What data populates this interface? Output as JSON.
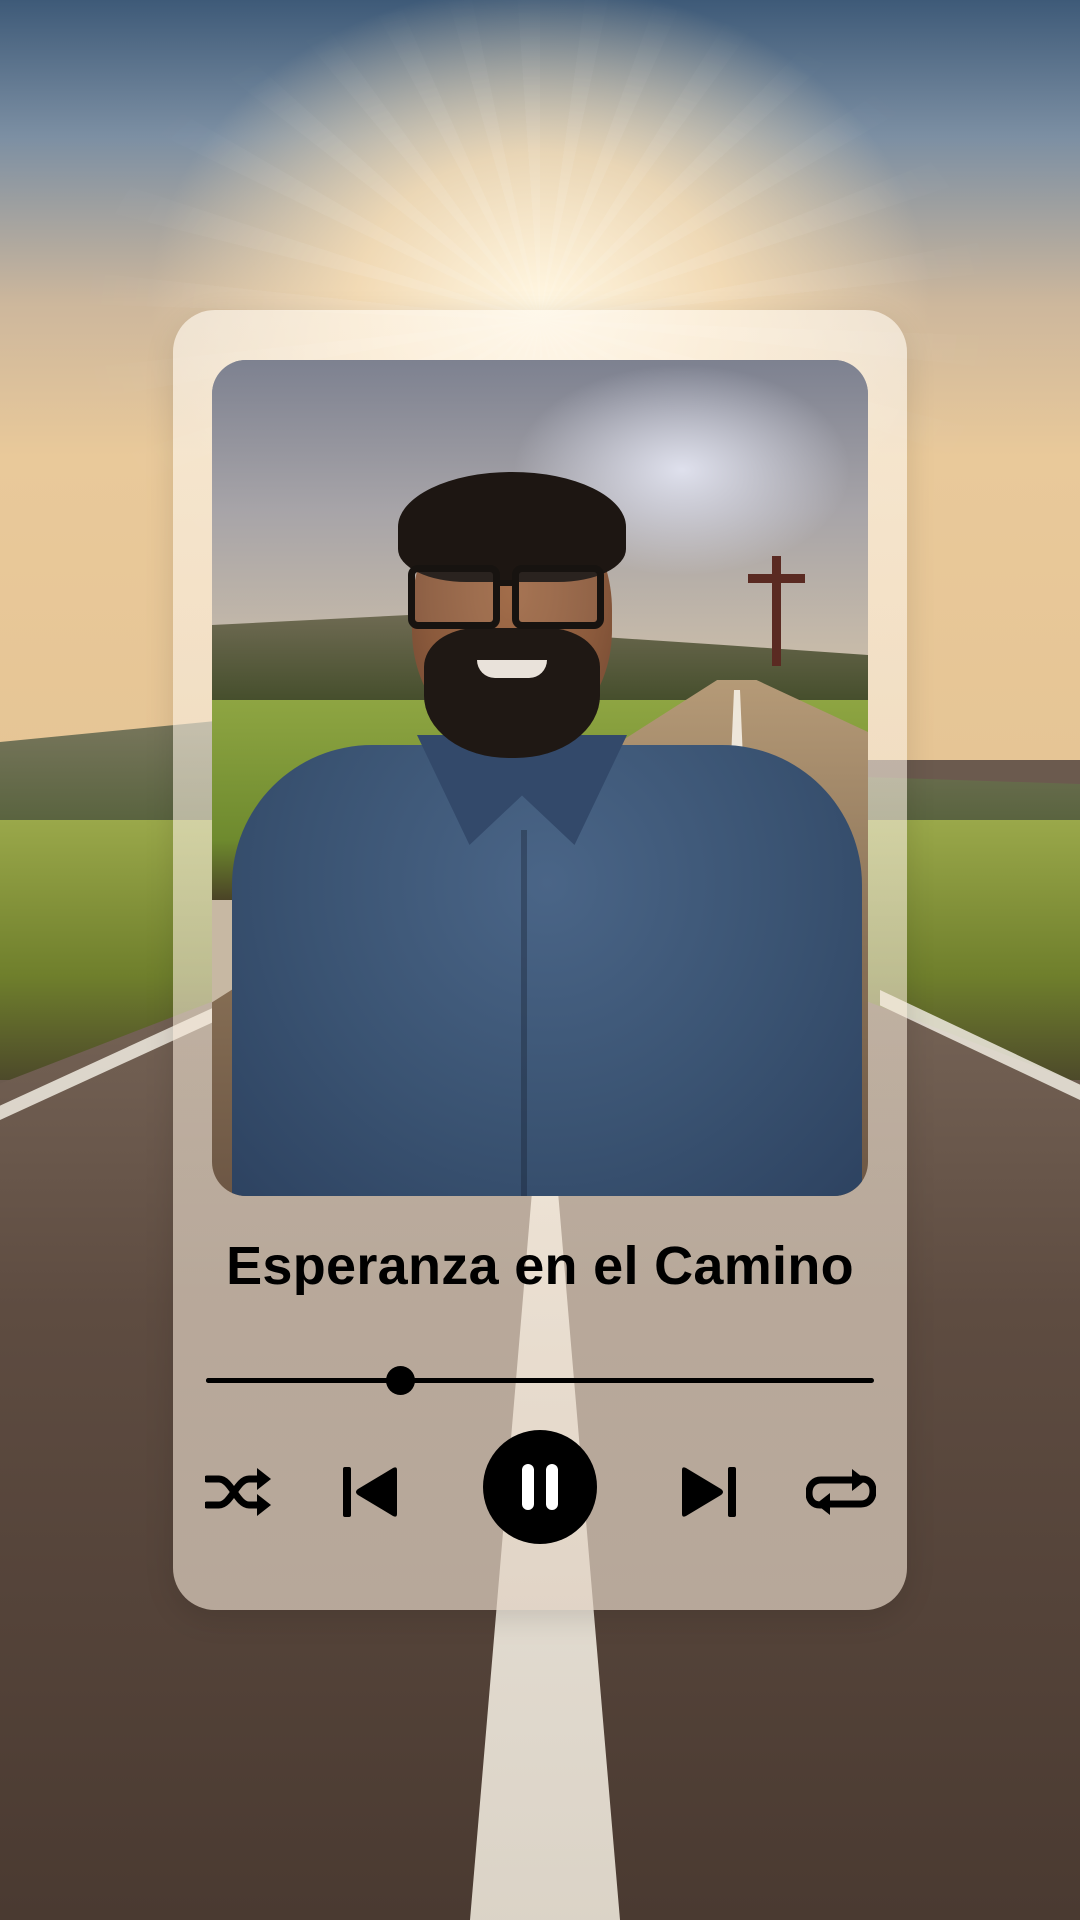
{
  "track": {
    "title": "Esperanza en el Camino",
    "progress_fraction": 0.29,
    "is_playing": true
  },
  "controls": {
    "shuffle": "shuffle-icon",
    "previous": "skip-previous-icon",
    "play_pause": "pause-icon",
    "next": "skip-next-icon",
    "repeat": "repeat-icon"
  },
  "colors": {
    "controls": "#000000",
    "card": "#f3e7d8"
  }
}
